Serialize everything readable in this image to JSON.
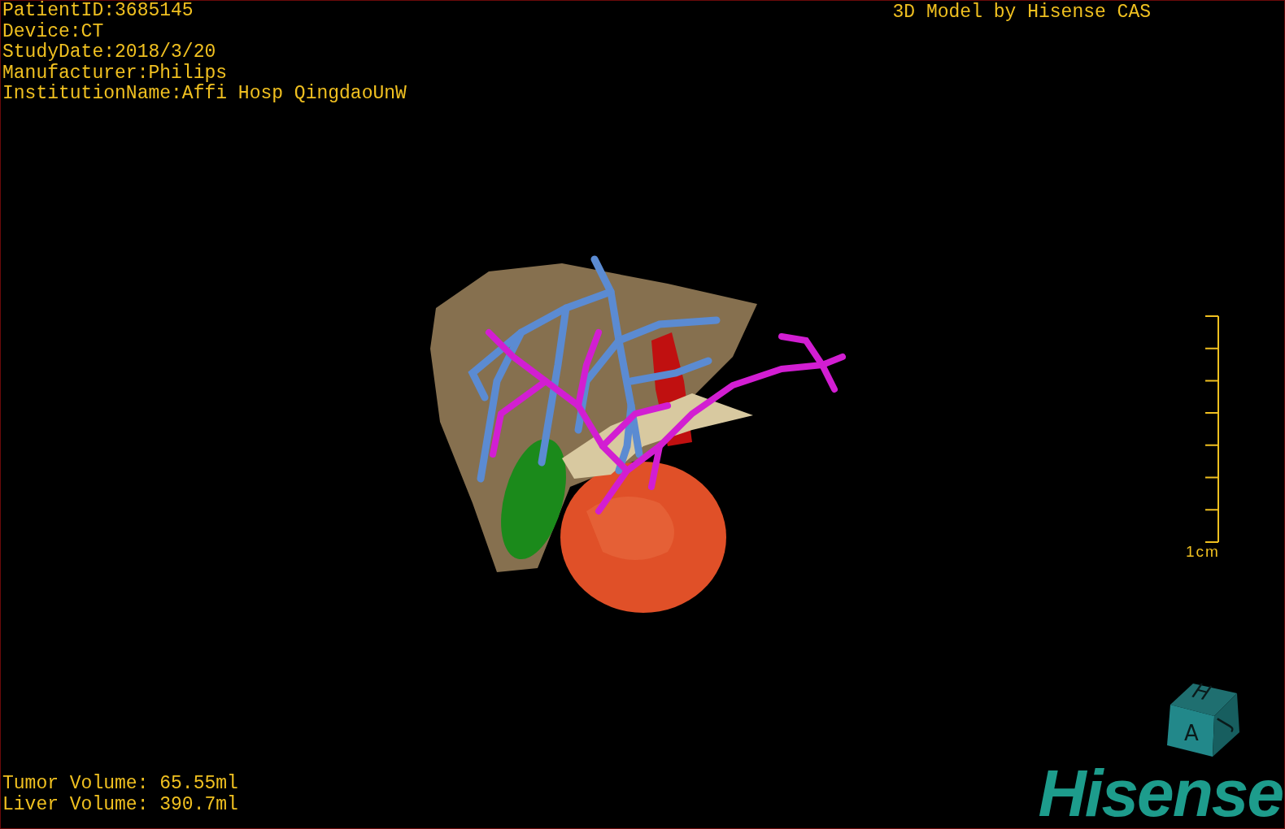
{
  "patient_info": [
    "PatientID:3685145",
    "Device:CT",
    "StudyDate:2018/3/20",
    "Manufacturer:Philips",
    "InstitutionName:Affi Hosp QingdaoUnW"
  ],
  "title": "3D Model by Hisense CAS",
  "scale_bar": {
    "label": "1cm"
  },
  "orientation_cube": {
    "faces": [
      {
        "kind": "top",
        "label": "H"
      },
      {
        "kind": "front",
        "label": "A"
      },
      {
        "kind": "side",
        "label": "J"
      }
    ]
  },
  "volumes": [
    "Tumor Volume: 65.55ml",
    "Liver Volume: 390.7ml"
  ],
  "logo": "Hisense"
}
